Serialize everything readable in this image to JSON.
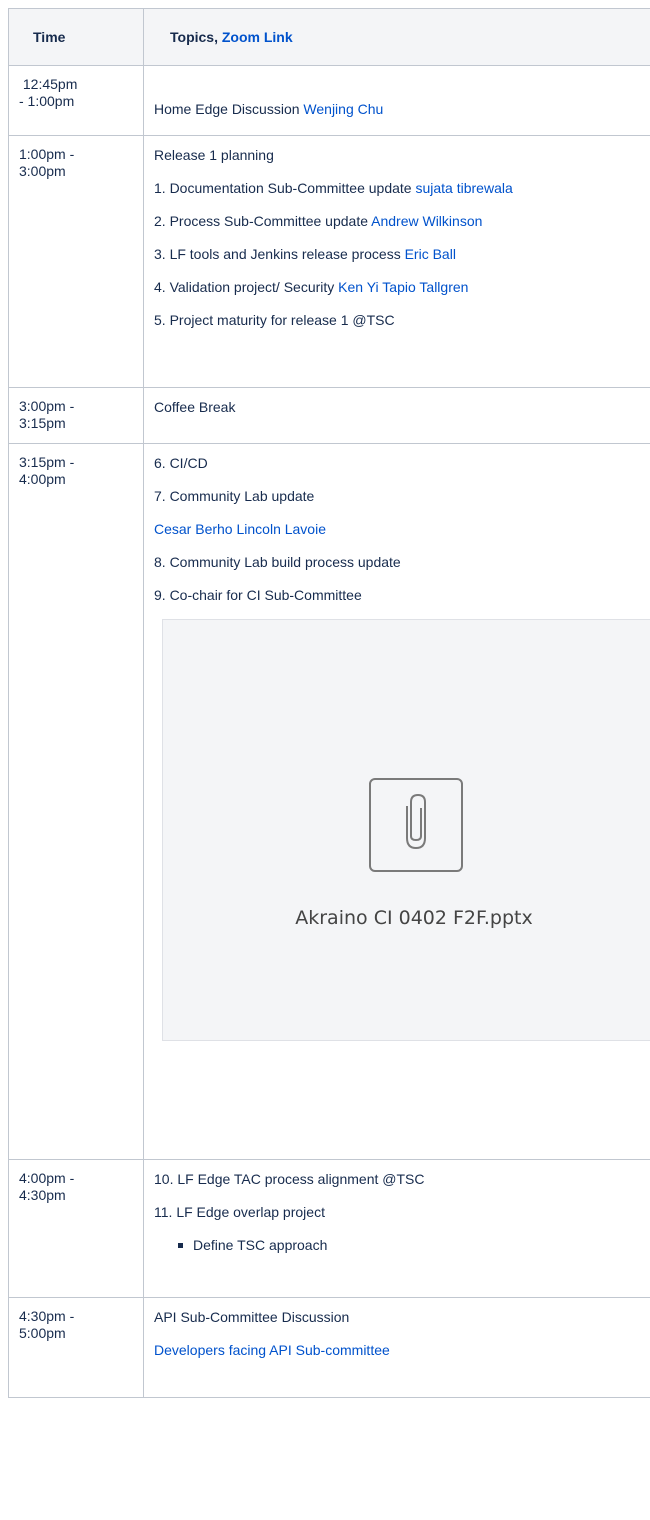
{
  "header": {
    "time": "Time",
    "topics": "Topics,",
    "zoom_link": "Zoom Link"
  },
  "rows": [
    {
      "time": "12:45pm\n- 1:00pm",
      "items": {
        "title": "Home Edge Discussion",
        "link": "Wenjing Chu"
      }
    },
    {
      "time": "1:00pm -\n3:00pm",
      "items": {
        "title": "Release 1 planning",
        "i1": "1. Documentation Sub-Committee update",
        "i1_link": "sujata tibrewala",
        "i2": "2. Process Sub-Committee update",
        "i2_link": "Andrew Wilkinson",
        "i3": "3. LF tools and Jenkins release process",
        "i3_link": "Eric Ball",
        "i4": "4. Validation project/ Security",
        "i4_link1": "Ken Yi",
        "i4_link2": "Tapio Tallgren",
        "i5": "5. Project maturity for release 1 @TSC"
      }
    },
    {
      "time": "3:00pm -\n3:15pm",
      "items": {
        "title": "Coffee Break"
      }
    },
    {
      "time": "3:15pm -\n4:00pm",
      "items": {
        "i6": "6. CI/CD",
        "i7": "7. Community Lab update",
        "i7_link1": "Cesar Berho",
        "i7_link2": "Lincoln Lavoie",
        "i8": "8. Community Lab build process update",
        "i9": "9. Co-chair for CI Sub-Committee",
        "attachment": "Akraino CI 0402 F2F.pptx",
        "attachment_icon": "paperclip-icon"
      }
    },
    {
      "time": "4:00pm -\n4:30pm",
      "items": {
        "i10": "10. LF Edge TAC process alignment @TSC",
        "i11": "11. LF Edge overlap project",
        "bullet": "Define TSC approach"
      }
    },
    {
      "time": "4:30pm -\n5:00pm",
      "items": {
        "title": "API Sub-Committee Discussion",
        "link": "Developers facing API Sub-committee"
      }
    }
  ]
}
